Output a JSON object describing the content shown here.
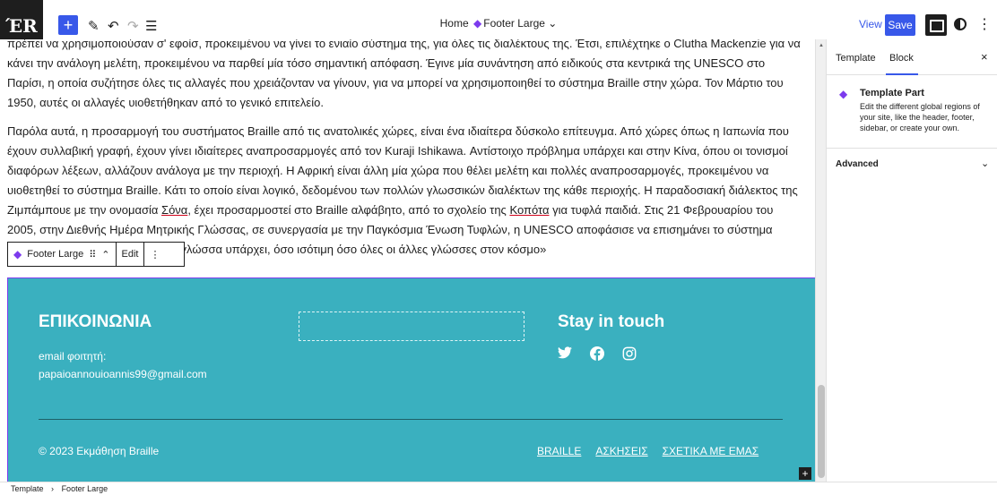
{
  "topbar": {
    "logo_text": "ΈR",
    "add_icon": "+",
    "pen_icon": "✎",
    "undo_icon": "↶",
    "redo_icon": "↷",
    "list_icon": "☰",
    "home": "Home",
    "template_name": "Footer Large",
    "chevron": "⌄",
    "view": "View",
    "save": "Save",
    "more": "⋮"
  },
  "content": {
    "para1_line0": "πρέπει να χρησιμοποιούσαν σ' εφοίσ, προκειμένου να γίνει το ενιαίο σύστημα της, για όλες τις διαλέκτους της. Έτσι, επιλέχτηκε ο Clutha Mackenzie για να κάνει",
    "para1": "την ανάλογη μελέτη, προκειμένου να παρθεί μία τόσο σημαντική απόφαση. Έγινε μία συνάντηση από ειδικούς στα κεντρικά της UNESCO στο Παρίσι, η οποία συζήτησε όλες τις αλλαγές που χρειάζονταν να γίνουν, για να μπορεί να χρησιμοποιηθεί το σύστημα Braille στην χώρα. Τον Μάρτιο του 1950, αυτές οι αλλαγές υιοθετήθηκαν από το γενικό επιτελείο.",
    "para2_a": "Παρόλα αυτά, η προσαρμογή του συστήματος Braille από τις ανατολικές χώρες, είναι ένα ιδιαίτερα δύσκολο επίτευγμα. Από χώρες όπως η Ιαπωνία που έχουν συλλαβική γραφή, έχουν γίνει ιδιαίτερες αναπροσαρμογές από τον Kuraji Ishikawa. Αντίστοιχο πρόβλημα υπάρχει και στην Κίνα, όπου οι τονισμοί διαφόρων λέξεων, αλλάζουν ανάλογα με την περιοχή. Η Αφρική είναι άλλη μία χώρα που θέλει μελέτη και πολλές αναπροσαρμογές, προκειμένου να υιοθετηθεί το σύστημα Braille. Κάτι το οποίο είναι λογικό, δεδομένου των πολλών γλωσσικών διαλέκτων της κάθε περιοχής. Η παραδοσιακή διάλεκτος της Ζιμπάμπουε με την ονομασία ",
    "para2_sona": "Σόνα",
    "para2_b": ", έχει προσαρμοστεί στο Braille αλφάβητο, από το σχολείο της ",
    "para2_kopota": "Κοπότα",
    "para2_c": " για τυφλά παιδιά. Στις 21 Φεβρουαρίου του 2005, στην Διεθνής Ημέρα Μητρικής Γλώσσας, σε συνεργασία με την Παγκόσμια Ένωση Τυφλών, η UNESCO αποφάσισε να επισημάνει το σύστημα Braille ως μία «ζωτικής σημασίας γλώσσα",
    "para2_tail": "υπάρχει, όσο ισότιμη όσο όλες οι άλλες γλώσσες στον κόσμο»"
  },
  "block_toolbar": {
    "label": "Footer Large",
    "drag": "⠿",
    "move": "⌃",
    "edit": "Edit",
    "more": "⋮"
  },
  "footer": {
    "heading": "ΕΠΙΚΟΙΝΩΝΙΑ",
    "email_label": "email φοιτητή:",
    "email": "papaioannouioannis99@gmail.com",
    "stay": "Stay in touch",
    "copyright": "© 2023 Εκμάθηση Braille",
    "links": [
      "BRAILLE",
      "ΑΣΚΗΣΕΙΣ",
      "ΣΧΕΤΙΚΑ ΜΕ ΕΜΑΣ"
    ],
    "insert": "+"
  },
  "sidebar": {
    "tab_template": "Template",
    "tab_block": "Block",
    "close": "×",
    "tp_title": "Template Part",
    "tp_desc": "Edit the different global regions of your site, like the header, footer, sidebar, or create your own.",
    "advanced": "Advanced",
    "adv_chevron": "⌄"
  },
  "breadcrumb": {
    "template": "Template",
    "sep": "›",
    "part": "Footer Large"
  },
  "colors": {
    "accent": "#3858e9",
    "footer_bg": "#3ab0bf",
    "template_part": "#7c3aed"
  }
}
